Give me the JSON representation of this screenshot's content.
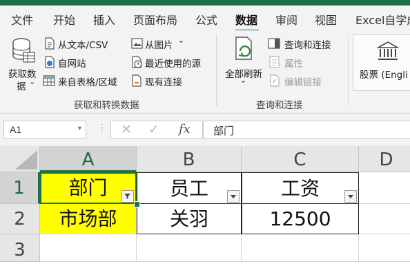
{
  "ribbon_tabs": [
    {
      "label": "文件"
    },
    {
      "label": "开始"
    },
    {
      "label": "插入"
    },
    {
      "label": "页面布局"
    },
    {
      "label": "公式"
    },
    {
      "label": "数据",
      "active": true
    },
    {
      "label": "审阅"
    },
    {
      "label": "视图"
    },
    {
      "label": "Excel自学成"
    }
  ],
  "get_transform": {
    "get_data_line1": "获取数",
    "get_data_line2": "据",
    "from_text_csv": "从文本/CSV",
    "from_web": "自网站",
    "from_table": "来自表格/区域",
    "from_picture": "从图片",
    "recent_sources": "最近使用的源",
    "existing_connections": "现有连接",
    "group_label": "获取和转换数据"
  },
  "queries": {
    "refresh_all_line1": "全部刷新",
    "queries_connections": "查询和连接",
    "properties": "属性",
    "edit_links": "编辑链接",
    "group_label": "查询和连接"
  },
  "data_types": {
    "stocks": "股票 (Engli"
  },
  "formula_bar": {
    "name_box": "A1",
    "fx": "fx",
    "formula": "部门"
  },
  "columns": [
    "A",
    "B",
    "C",
    "D"
  ],
  "rows": [
    "1",
    "2",
    "3"
  ],
  "cells": {
    "A1": "部门",
    "B1": "员工",
    "C1": "工资",
    "A2": "市场部",
    "B2": "关羽",
    "C2": "12500"
  },
  "colors": {
    "accent": "#1e7145",
    "highlight": "#ffff00"
  }
}
